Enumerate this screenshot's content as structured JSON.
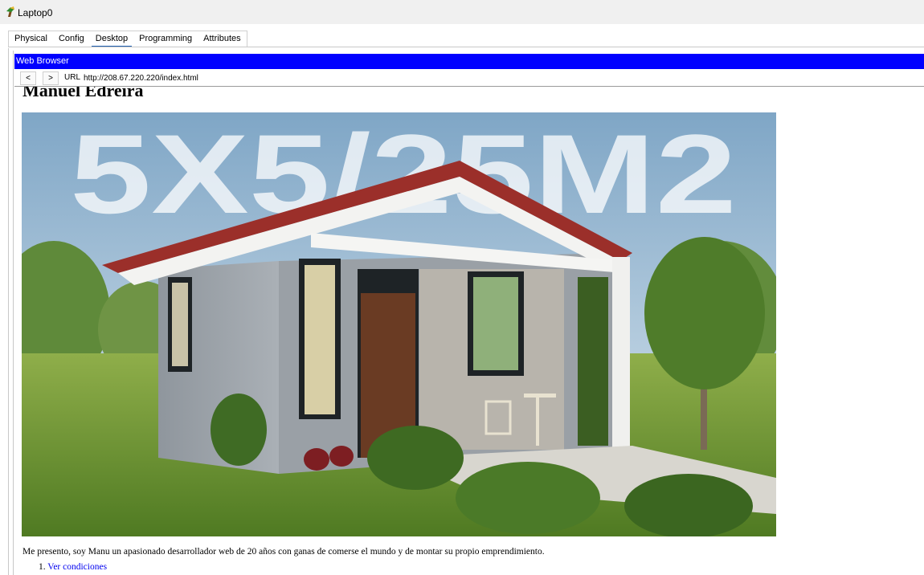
{
  "window": {
    "title": "Laptop0",
    "icon": "laptop-icon"
  },
  "tabs": [
    {
      "label": "Physical",
      "active": false
    },
    {
      "label": "Config",
      "active": false
    },
    {
      "label": "Desktop",
      "active": true
    },
    {
      "label": "Programming",
      "active": false
    },
    {
      "label": "Attributes",
      "active": false
    }
  ],
  "browser": {
    "header": "Web Browser",
    "back_label": "<",
    "forward_label": ">",
    "url_label": "URL",
    "url_value": "http://208.67.220.220/index.html"
  },
  "page": {
    "title": "Manuel Edreira",
    "hero_text": "5X5/25M2",
    "intro": "Me presento, soy Manu un apasionado desarrollador web de 20 años con ganas de comerse el mundo y de montar su propio emprendimiento.",
    "list": [
      {
        "number": "1.",
        "link": "Ver condiciones"
      }
    ]
  },
  "colors": {
    "browser_header": "#0000ff",
    "link": "#0000ee",
    "active_tab_underline": "#1f5fb0"
  }
}
